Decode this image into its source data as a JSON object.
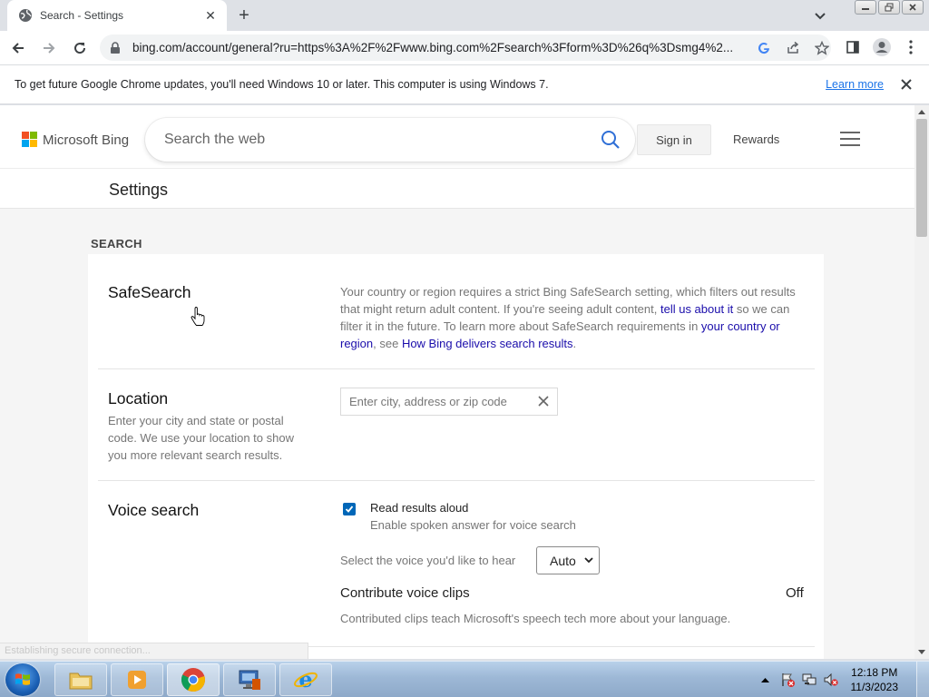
{
  "browser": {
    "tab": {
      "title": "Search - Settings"
    },
    "url": "bing.com/account/general?ru=https%3A%2F%2Fwww.bing.com%2Fsearch%3Fform%3D%26q%3Dsmg4%2..."
  },
  "infobar": {
    "message": "To get future Google Chrome updates, you'll need Windows 10 or later. This computer is using Windows 7.",
    "link": "Learn more"
  },
  "bing": {
    "logo_text": "Microsoft Bing",
    "search_placeholder": "Search the web",
    "sign_in": "Sign in",
    "rewards": "Rewards",
    "brand_colors": [
      "#f25022",
      "#7fba00",
      "#00a4ef",
      "#ffb900"
    ]
  },
  "settings": {
    "title": "Settings",
    "section": "SEARCH",
    "safesearch": {
      "title": "SafeSearch",
      "text_1": "Your country or region requires a strict Bing SafeSearch setting, which filters out results that might return adult content. If you're seeing adult content, ",
      "link_1": "tell us about it",
      "text_2": " so we can filter it in the future. To learn more about SafeSearch requirements in ",
      "link_2": "your country or region",
      "text_3": ", see ",
      "link_3": "How Bing delivers search results",
      "text_4": "."
    },
    "location": {
      "title": "Location",
      "description": "Enter your city and state or postal code. We use your location to show you more relevant search results.",
      "placeholder": "Enter city, address or zip code"
    },
    "voice": {
      "title": "Voice search",
      "read_aloud_label": "Read results aloud",
      "read_aloud_checked": true,
      "read_aloud_sub": "Enable spoken answer for voice search",
      "select_label": "Select the voice you'd like to hear",
      "select_value": "Auto",
      "contribute_title": "Contribute voice clips",
      "contribute_value": "Off",
      "contribute_desc": "Contributed clips teach Microsoft's speech tech more about your language."
    }
  },
  "status_bar": "Establishing secure connection...",
  "taskbar": {
    "time": "12:18 PM",
    "date": "11/3/2023"
  }
}
